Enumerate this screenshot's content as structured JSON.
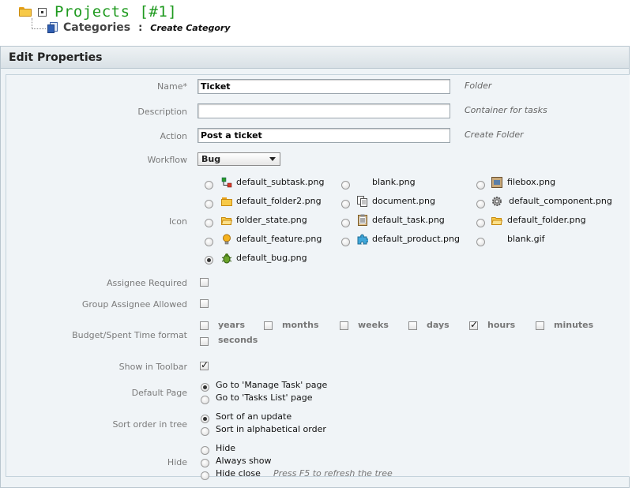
{
  "header": {
    "project_title": "Projects [#1]",
    "categories_label": "Categories",
    "separator": ":",
    "action_label": "Create Category"
  },
  "panel": {
    "title": "Edit Properties"
  },
  "form": {
    "name": {
      "label": "Name*",
      "value": "Ticket",
      "hint": "Folder"
    },
    "description": {
      "label": "Description",
      "value": "",
      "hint": "Container for tasks"
    },
    "action": {
      "label": "Action",
      "value": "Post a ticket",
      "hint": "Create Folder"
    },
    "workflow": {
      "label": "Workflow",
      "value": "Bug"
    },
    "icon": {
      "label": "Icon",
      "options": [
        {
          "name": "default_subtask.png",
          "icon": "subtask-icon",
          "selected": false
        },
        {
          "name": "blank.png",
          "icon": "blank-icon",
          "selected": false
        },
        {
          "name": "filebox.png",
          "icon": "filebox-icon",
          "selected": false
        },
        {
          "name": "default_folder2.png",
          "icon": "folder-icon",
          "selected": false
        },
        {
          "name": "document.png",
          "icon": "document-icon",
          "selected": false
        },
        {
          "name": "default_component.png",
          "icon": "gear-icon",
          "selected": false
        },
        {
          "name": "folder_state.png",
          "icon": "open-folder-icon",
          "selected": false
        },
        {
          "name": "default_task.png",
          "icon": "clipboard-icon",
          "selected": false
        },
        {
          "name": "default_folder.png",
          "icon": "open-folder-icon",
          "selected": false
        },
        {
          "name": "default_feature.png",
          "icon": "lightbulb-icon",
          "selected": false
        },
        {
          "name": "default_product.png",
          "icon": "puzzle-icon",
          "selected": false
        },
        {
          "name": "blank.gif",
          "icon": "blank-icon",
          "selected": false
        },
        {
          "name": "default_bug.png",
          "icon": "bug-icon",
          "selected": true
        }
      ]
    },
    "assignee_required": {
      "label": "Assignee Required",
      "checked": false
    },
    "group_assignee_allowed": {
      "label": "Group Assignee Allowed",
      "checked": false
    },
    "budget_format": {
      "label": "Budget/Spent Time format",
      "units": [
        {
          "name": "years",
          "checked": false
        },
        {
          "name": "months",
          "checked": false
        },
        {
          "name": "weeks",
          "checked": false
        },
        {
          "name": "days",
          "checked": false
        },
        {
          "name": "hours",
          "checked": true
        },
        {
          "name": "minutes",
          "checked": false
        },
        {
          "name": "seconds",
          "checked": false
        }
      ]
    },
    "show_in_toolbar": {
      "label": "Show in Toolbar",
      "checked": true
    },
    "default_page": {
      "label": "Default Page",
      "options": [
        "Go to 'Manage Task' page",
        "Go to 'Tasks List' page"
      ],
      "selected": 0
    },
    "sort_order": {
      "label": "Sort order in tree",
      "options": [
        "Sort of an update",
        "Sort in alphabetical order"
      ],
      "selected": 0
    },
    "hide": {
      "label": "Hide",
      "options": [
        "Hide",
        "Always show",
        "Hide close"
      ],
      "hint": "Press F5 to refresh the tree",
      "selected": -1
    }
  }
}
